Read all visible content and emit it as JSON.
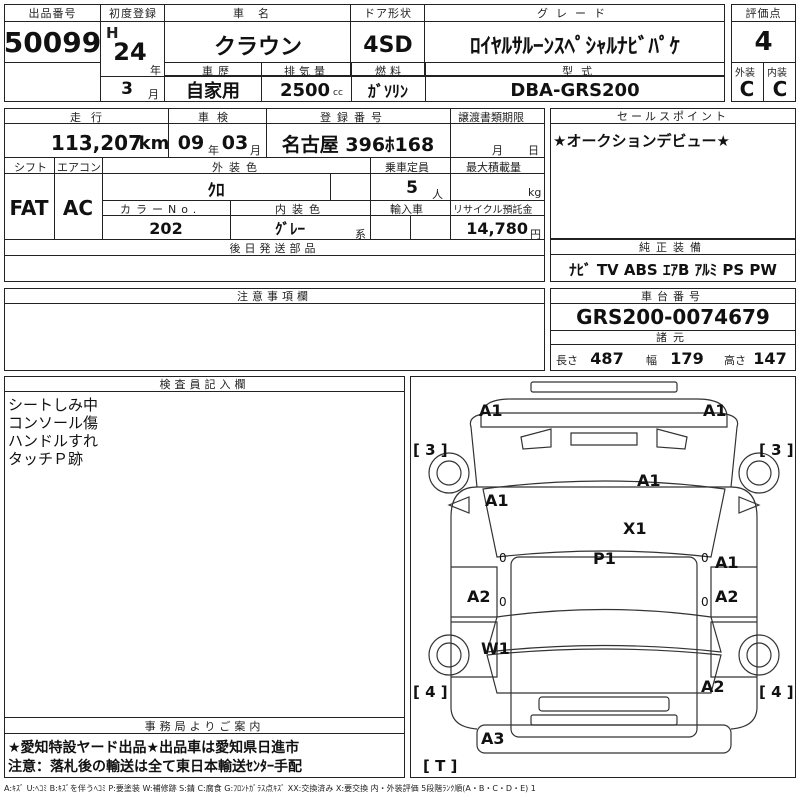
{
  "header": {
    "lot_label": "出品番号",
    "lot_number": "50099",
    "first_reg_label": "初度登録",
    "era": "H",
    "year": "24",
    "year_unit": "年",
    "month": "3",
    "month_unit": "月",
    "car_name_label": "車名",
    "car_name": "クラウン",
    "door_label": "ドア形状",
    "door": "4SD",
    "grade_label": "グレード",
    "grade": "ﾛｲﾔﾙｻﾙｰﾝｽﾍﾟｼｬﾙﾅﾋﾞﾊﾟｹ",
    "score_label": "評価点",
    "score": "4",
    "history_label": "車歴",
    "history": "自家用",
    "displacement_label": "排気量",
    "displacement": "2500",
    "displacement_unit": "cc",
    "fuel_label": "燃料",
    "fuel": "ｶﾞｿﾘﾝ",
    "model_label": "型式",
    "model": "DBA-GRS200",
    "exterior_label": "外装",
    "exterior_grade": "C",
    "interior_label": "内装",
    "interior_grade": "C"
  },
  "row2": {
    "mileage_label": "走行",
    "mileage": "113,207",
    "mileage_unit": "km",
    "inspection_label": "車検",
    "insp_year": "09",
    "insp_year_unit": "年",
    "insp_month": "03",
    "insp_month_unit": "月",
    "reg_label": "登録番号",
    "reg_number": "名古屋 396ﾎ168",
    "transfer_label": "譲渡書類期限",
    "transfer_month_unit": "月",
    "transfer_day_unit": "日",
    "sales_point_label": "セールスポイント",
    "sales_point": "★オークションデビュー★"
  },
  "row3": {
    "shift_label": "シフト",
    "shift": "FAT",
    "ac_label": "エアコン",
    "ac": "AC",
    "ext_color_label": "外装色",
    "ext_color": "ｸﾛ",
    "capacity_label": "乗車定員",
    "capacity": "5",
    "capacity_unit": "人",
    "max_load_label": "最大積載量",
    "max_load_unit": "kg",
    "color_no_label": "カラーNo.",
    "color_no": "202",
    "int_color_label": "内装色",
    "int_color": "ｸﾞﾚｰ",
    "int_color_unit": "系",
    "import_label": "輸入車",
    "recycle_label": "リサイクル預託金",
    "recycle": "14,780",
    "recycle_unit": "円"
  },
  "later_parts_label": "後日発送部品",
  "equipment_label": "純正装備",
  "equipment": "ﾅﾋﾞ TV ABS ｴｱB ｱﾙﾐ PS PW",
  "notes_label": "注意事項欄",
  "chassis_label": "車台番号",
  "chassis": "GRS200-0074679",
  "specs_label": "諸元",
  "length_label": "長さ",
  "length": "487",
  "width_label": "幅",
  "width": "179",
  "height_label": "高さ",
  "height": "147",
  "inspector_label": "検査員記入欄",
  "inspector_notes": [
    "シートしみ中",
    "コンソール傷",
    "ハンドルすれ",
    "タッチＰ跡"
  ],
  "office_label": "事務局よりご案内",
  "office_lines": [
    "★愛知特設ヤード出品★出品車は愛知県日進市",
    "注意：落札後の輸送は全て東日本輸送ｾﾝﾀｰ手配"
  ],
  "diagram": {
    "front_left": "A1",
    "front_right": "A1",
    "windshield": "A1",
    "left_front_door": "A1",
    "roof": "X1",
    "interior": "P1",
    "right_front_door": "A1",
    "left_rear_door": "A2",
    "right_rear_door": "A2",
    "left_rear_wheel": "W1",
    "rear_right": "A2",
    "rear_bumper": "A3",
    "left_zero_1": "0",
    "left_zero_2": "0",
    "right_zero_1": "0",
    "right_zero_2": "0",
    "tire_fl": "[ 3 ]",
    "tire_fr": "[ 3 ]",
    "tire_rl": "[ 4 ]",
    "tire_rr": "[ 4 ]",
    "spare": "[ T ]"
  },
  "legend": "A:ｷｽﾞ U:ﾍｺﾐ B:ｷｽﾞを伴うﾍｺﾐ P:要塗装 W:補修跡 S:錆 C:腐食 G:ﾌﾛﾝﾄｶﾞﾗｽ点ｷｽﾞ XX:交換済み X:要交換 内・外装評価 5段階ﾗﾝｸ順(A・B・C・D・E) 1"
}
